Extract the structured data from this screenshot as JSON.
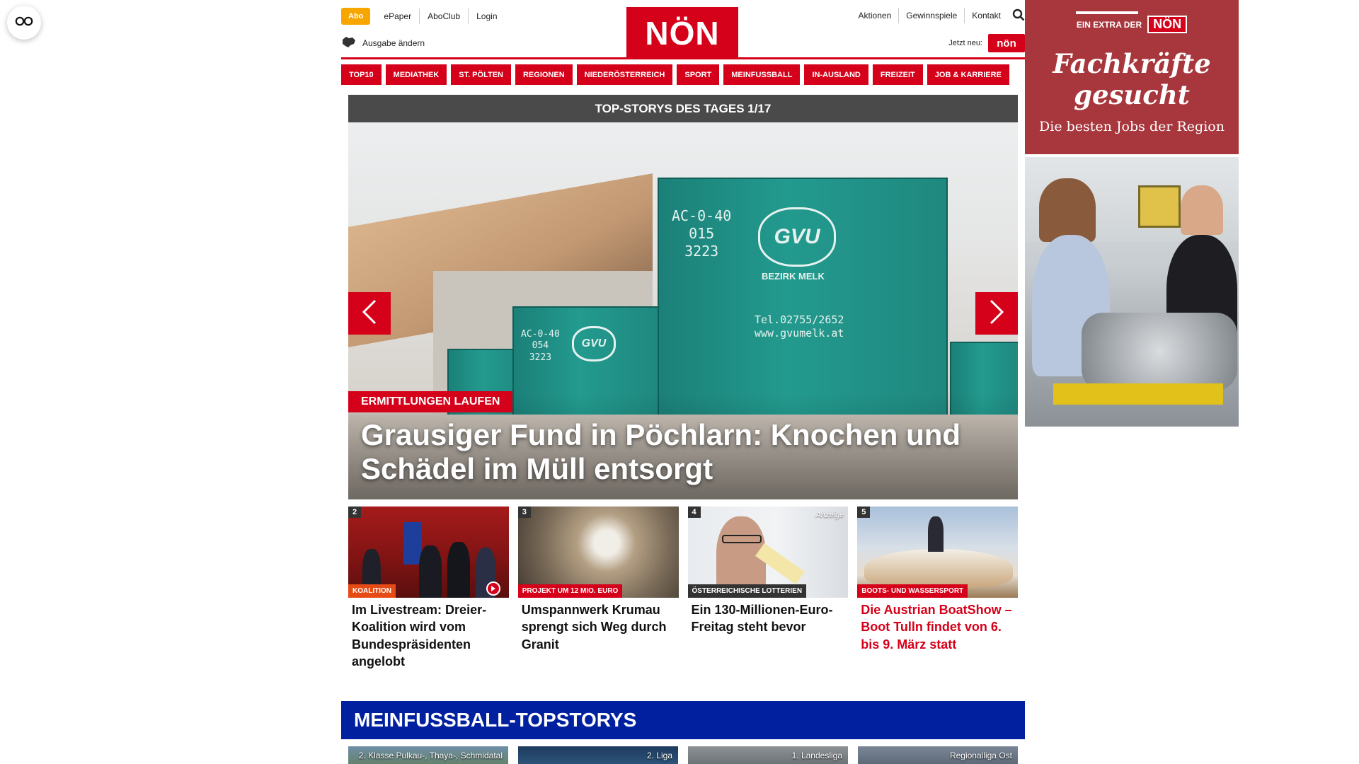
{
  "header": {
    "abo": "Abo",
    "top_links": [
      "ePaper",
      "AboClub",
      "Login"
    ],
    "edition": "Ausgabe ändern",
    "logo": "NÖN",
    "right_links": [
      "Aktionen",
      "Gewinnspiele",
      "Kontakt"
    ],
    "jetzt": "Jetzt neu:",
    "jetzt_logo": "nön"
  },
  "nav": [
    "TOP10",
    "MEDIATHEK",
    "ST. PÖLTEN",
    "REGIONEN",
    "NIEDERÖSTERREICH",
    "SPORT",
    "MEINFUSSBALL",
    "IN-AUSLAND",
    "FREIZEIT",
    "JOB & KARRIERE"
  ],
  "slider": {
    "heading": "TOP-STORYS DES TAGES 1/17",
    "kicker": "ERMITTLUNGEN LAUFEN",
    "title": "Grausiger Fund in Pöchlarn: Knochen und Schädel im Müll entsorgt",
    "container_text_main": "AC-0-40\n015\n3223",
    "container_logo": "GVU",
    "container_district": "BEZIRK MELK",
    "container_contact": "Tel.02755/2652\nwww.gvumelk.at",
    "container_text_small": "AC-0-40\n054\n3223"
  },
  "cards": [
    {
      "num": "2",
      "tag": "KOALITION",
      "title": "Im Livestream: Dreier-Koalition wird vom Bundespräsidenten angelobt",
      "red": false
    },
    {
      "num": "3",
      "tag": "PROJEKT UM 12 MIO. EURO",
      "title": "Umspannwerk Krumau sprengt sich Weg durch Granit",
      "red": false
    },
    {
      "num": "4",
      "tag": "ÖSTERREICHISCHE LOTTERIEN",
      "anzeige": "Anzeige",
      "title": "Ein 130-Millionen-Euro-Freitag steht bevor",
      "red": false
    },
    {
      "num": "5",
      "tag": "BOOTS- UND WASSERSPORT",
      "title": "Die Austrian BoatShow – Boot Tulln findet von 6. bis 9. März statt",
      "red": true
    }
  ],
  "meinfussball": {
    "heading": "MEINFUSSBALL-TOPSTORYS",
    "items": [
      "2. Klasse Pulkau-, Thaya-, Schmidatal",
      "2. Liga",
      "1. Landesliga",
      "Regionalliga Ost"
    ]
  },
  "ad": {
    "extra": "EIN EXTRA DER",
    "logo": "NÖN",
    "headline": "Fachkräfte gesucht",
    "sub": "Die besten Jobs der Region"
  },
  "colors": {
    "brand_red": "#d50019",
    "abo_orange": "#f7a600",
    "mfb_blue": "#00209f",
    "ad_red": "#a8373d"
  }
}
